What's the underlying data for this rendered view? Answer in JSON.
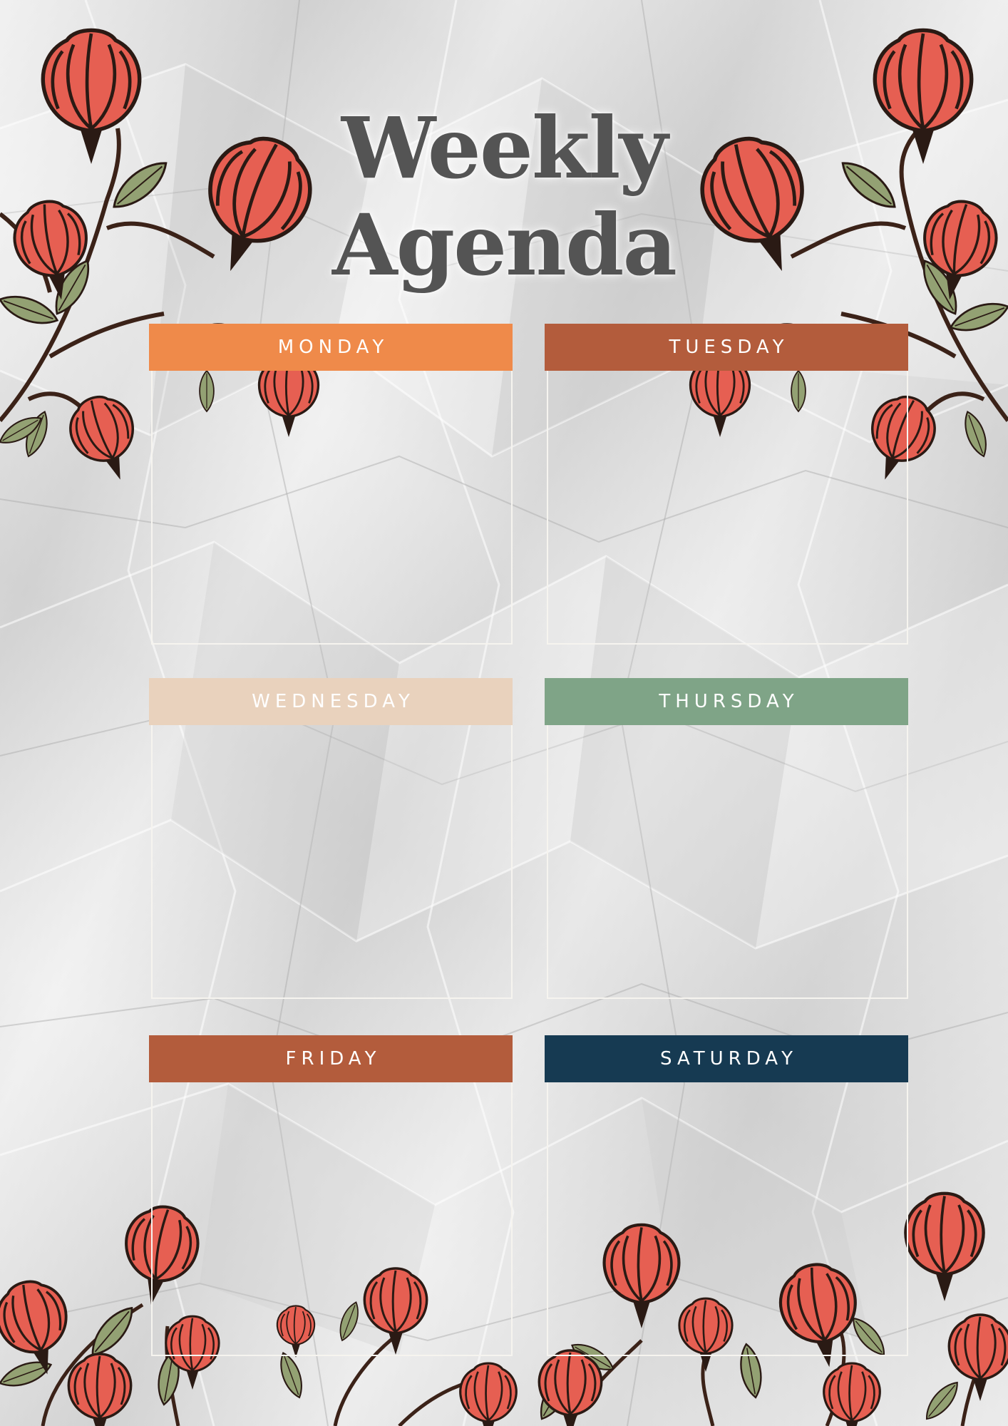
{
  "title": {
    "line1": "Weekly",
    "line2": "Agenda"
  },
  "days": [
    {
      "label": "MONDAY",
      "color": "#ef8a4a"
    },
    {
      "label": "TUESDAY",
      "color": "#b35c3c"
    },
    {
      "label": "WEDNESDAY",
      "color": "#e9d2bd"
    },
    {
      "label": "THURSDAY",
      "color": "#7fa487"
    },
    {
      "label": "FRIDAY",
      "color": "#b35c3c"
    },
    {
      "label": "SATURDAY",
      "color": "#163a52"
    }
  ],
  "palette": {
    "petal": "#e65f52",
    "petal_outline": "#2a1a14",
    "leaf": "#93a173",
    "stem": "#3b2218",
    "title_text": "#545454"
  },
  "decor": {
    "icon": "red-tulip-flower-icon"
  }
}
